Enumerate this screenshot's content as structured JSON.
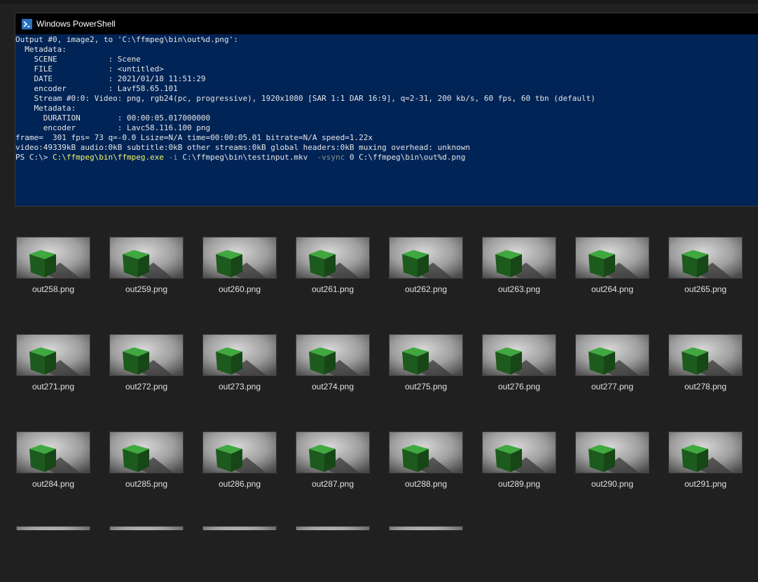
{
  "window": {
    "title": "Windows PowerShell",
    "icon": "powershell-icon"
  },
  "console": {
    "lines": [
      "Output #0, image2, to 'C:\\ffmpeg\\bin\\out%d.png':",
      "  Metadata:",
      "    SCENE           : Scene",
      "    FILE            : <untitled>",
      "    DATE            : 2021/01/18 11:51:29",
      "    encoder         : Lavf58.65.101",
      "    Stream #0:0: Video: png, rgb24(pc, progressive), 1920x1080 [SAR 1:1 DAR 16:9], q=2-31, 200 kb/s, 60 fps, 60 tbn (default)",
      "    Metadata:",
      "      DURATION        : 00:00:05.017000000",
      "      encoder         : Lavc58.116.100 png",
      "frame=  301 fps= 73 q=-0.0 Lsize=N/A time=00:00:05.01 bitrate=N/A speed=1.22x",
      "video:49339kB audio:0kB subtitle:0kB other streams:0kB global headers:0kB muxing overhead: unknown"
    ],
    "prompt": {
      "ps": "PS C:\\> ",
      "exe": "C:\\ffmpeg\\bin\\ffmpeg.exe",
      "flag_i": " -i",
      "input": " C:\\ffmpeg\\bin\\testinput.mkv",
      "flag_vsync": "  -vsync",
      "rest": " 0 C:\\ffmpeg\\bin\\out%d.png"
    }
  },
  "files": [
    "out258.png",
    "out259.png",
    "out260.png",
    "out261.png",
    "out262.png",
    "out263.png",
    "out264.png",
    "out265.png",
    "out271.png",
    "out272.png",
    "out273.png",
    "out274.png",
    "out275.png",
    "out276.png",
    "out277.png",
    "out278.png",
    "out284.png",
    "out285.png",
    "out286.png",
    "out287.png",
    "out288.png",
    "out289.png",
    "out290.png",
    "out291.png"
  ],
  "partial_row_count": 5,
  "colors": {
    "console_bg": "#012456",
    "explorer_bg": "#202020",
    "cube_green": "#1e6a1e"
  }
}
